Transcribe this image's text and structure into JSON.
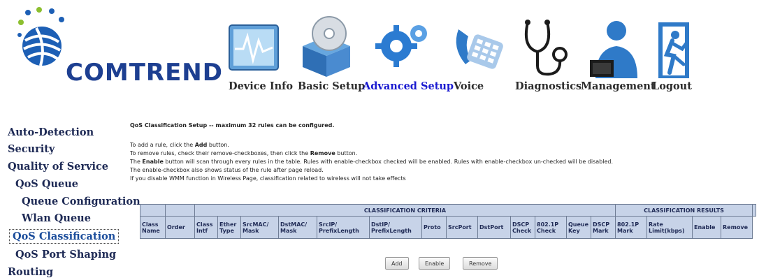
{
  "brand": {
    "name": "COMTREND"
  },
  "nav": [
    {
      "label": "Device Info",
      "icon": "monitor-chart-icon"
    },
    {
      "label": "Basic Setup",
      "icon": "disc-box-icon"
    },
    {
      "label": "Advanced Setup",
      "icon": "gears-icon",
      "active": true
    },
    {
      "label": "Voice",
      "icon": "phone-icon"
    },
    {
      "label": "Diagnostics",
      "icon": "stethoscope-icon"
    },
    {
      "label": "Management",
      "icon": "person-laptop-icon"
    },
    {
      "label": "Logout",
      "icon": "running-exit-icon"
    }
  ],
  "sidebar": [
    {
      "label": "Auto-Detection"
    },
    {
      "label": "Security"
    },
    {
      "label": "Quality of Service"
    },
    {
      "label": "QoS Queue"
    },
    {
      "label": "Queue Configuration"
    },
    {
      "label": "Wlan Queue"
    },
    {
      "label": "QoS Classification",
      "selected": true
    },
    {
      "label": "QoS Port Shaping"
    },
    {
      "label": "Routing"
    }
  ],
  "main": {
    "title": "QoS Classification Setup -- maximum 32 rules can be configured.",
    "lines": {
      "add_pre": "To add a rule, click the ",
      "add_bold": "Add",
      "add_post": " button.",
      "remove_pre": "To remove rules, check their remove-checkboxes, then click the ",
      "remove_bold": "Remove",
      "remove_post": " button.",
      "enable_pre": "The ",
      "enable_bold": "Enable",
      "enable_post": " button will scan through every rules in the table. Rules with enable-checkbox checked will be enabled. Rules with enable-checkbox un-checked will be disabled.",
      "status": "The enable-checkbox also shows status of the rule after page reload.",
      "wmm": "If you disable WMM function in Wireless Page, classification related to wireless will not take effects"
    },
    "table": {
      "group_criteria": "CLASSIFICATION CRITERIA",
      "group_results": "CLASSIFICATION RESULTS",
      "columns": {
        "class_name": "Class Name",
        "order": "Order",
        "class_intf": "Class Intf",
        "ether_type": "Ether Type",
        "src_mac": "SrcMAC/ Mask",
        "dst_mac": "DstMAC/ Mask",
        "src_ip": "SrcIP/ PrefixLength",
        "dst_ip": "DstIP/ PrefixLength",
        "proto": "Proto",
        "src_port": "SrcPort",
        "dst_port": "DstPort",
        "dscp_check": "DSCP Check",
        "p8021_check": "802.1P Check",
        "queue_key": "Queue Key",
        "dscp_mark": "DSCP Mark",
        "p8021_mark": "802.1P Mark",
        "rate_limit": "Rate Limit(kbps)",
        "enable": "Enable",
        "remove": "Remove"
      }
    },
    "buttons": {
      "add": "Add",
      "enable": "Enable",
      "remove": "Remove"
    }
  }
}
